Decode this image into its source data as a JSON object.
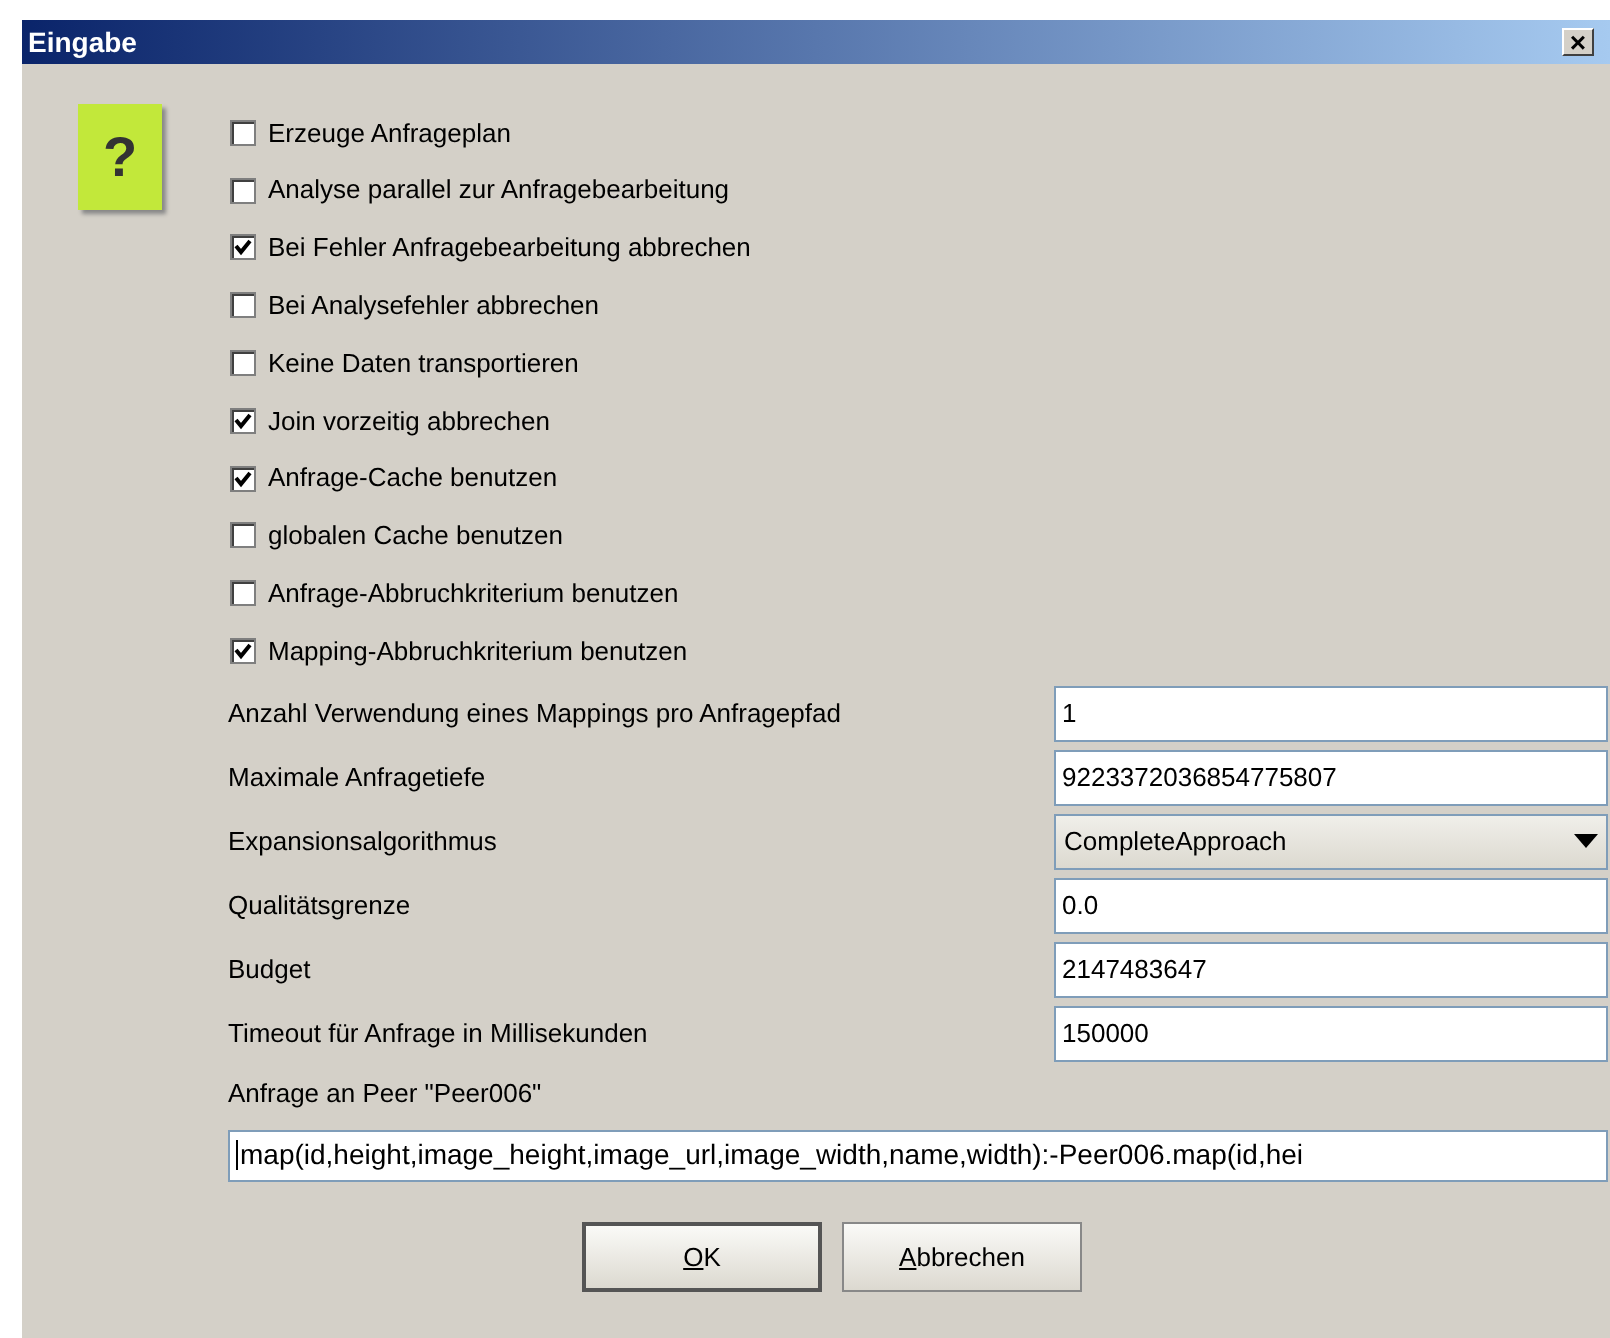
{
  "window": {
    "title": "Eingabe",
    "close": "×"
  },
  "icon": {
    "glyph": "?"
  },
  "options": [
    {
      "label": "Erzeuge Anfrageplan",
      "checked": false
    },
    {
      "label": "Analyse parallel zur Anfragebearbeitung",
      "checked": false
    },
    {
      "label": "Bei Fehler Anfragebearbeitung abbrechen",
      "checked": true
    },
    {
      "label": "Bei Analysefehler abbrechen",
      "checked": false
    },
    {
      "label": "Keine Daten transportieren",
      "checked": false
    },
    {
      "label": "Join vorzeitig abbrechen",
      "checked": true
    },
    {
      "label": "Anfrage-Cache benutzen",
      "checked": true
    },
    {
      "label": "globalen Cache benutzen",
      "checked": false
    },
    {
      "label": "Anfrage-Abbruchkriterium benutzen",
      "checked": false
    },
    {
      "label": "Mapping-Abbruchkriterium benutzen",
      "checked": true
    }
  ],
  "fields": [
    {
      "kind": "text",
      "label": "Anzahl Verwendung eines Mappings pro Anfragepfad",
      "value": "1"
    },
    {
      "kind": "text",
      "label": "Maximale Anfragetiefe",
      "value": "9223372036854775807"
    },
    {
      "kind": "dropdown",
      "label": "Expansionsalgorithmus",
      "value": "CompleteApproach"
    },
    {
      "kind": "text",
      "label": "Qualitätsgrenze",
      "value": "0.0"
    },
    {
      "kind": "text",
      "label": "Budget",
      "value": "2147483647"
    },
    {
      "kind": "text",
      "label": "Timeout für Anfrage in Millisekunden",
      "value": "150000"
    }
  ],
  "query": {
    "label": "Anfrage an Peer \"Peer006\"",
    "value": "map(id,height,image_height,image_url,image_width,name,width):-Peer006.map(id,hei"
  },
  "buttons": [
    {
      "label": "OK",
      "default": true
    },
    {
      "label": "Abbrechen",
      "default": false
    }
  ]
}
